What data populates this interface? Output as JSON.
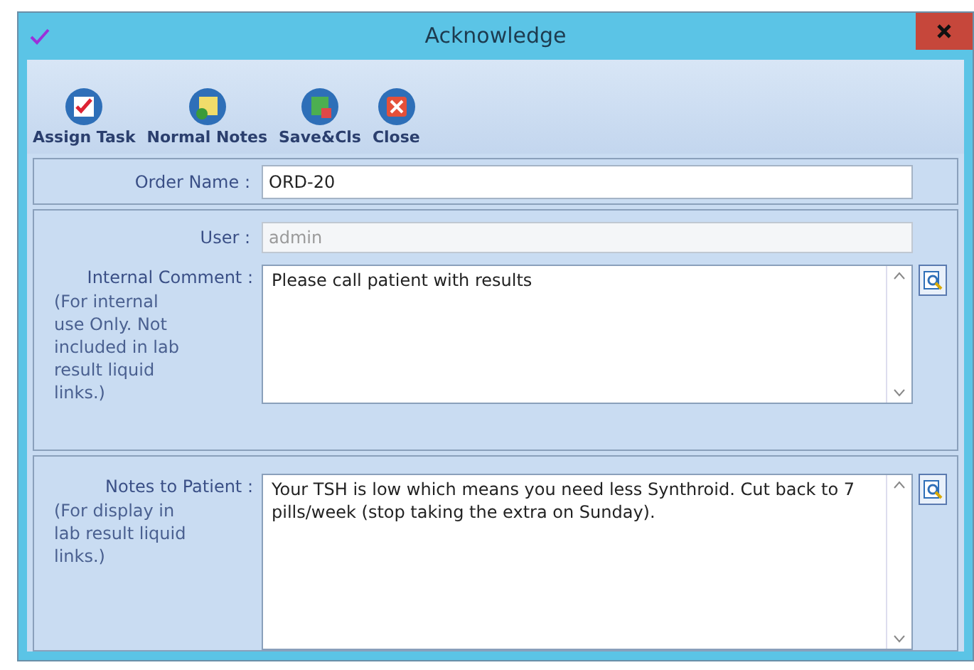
{
  "window": {
    "title": "Acknowledge"
  },
  "toolbar": [
    {
      "label": "Assign Task",
      "kind": "assign"
    },
    {
      "label": "Normal Notes",
      "kind": "notes"
    },
    {
      "label": "Save&Cls",
      "kind": "save"
    },
    {
      "label": "Close",
      "kind": "close"
    }
  ],
  "order_name": {
    "label": "Order Name :",
    "value": "ORD-20"
  },
  "user": {
    "label": "User :",
    "value": "admin",
    "disabled": true
  },
  "internal_comment": {
    "label": "Internal Comment  :",
    "note": "(For internal use Only. Not included in lab result liquid links.)",
    "value": "Please call patient with results"
  },
  "notes_to_patient": {
    "label": "Notes to Patient :",
    "note": "(For display in lab result liquid links.)",
    "value": "Your TSH is low which means you need less Synthroid. Cut back to 7 pills/week (stop taking the extra on Sunday)."
  }
}
